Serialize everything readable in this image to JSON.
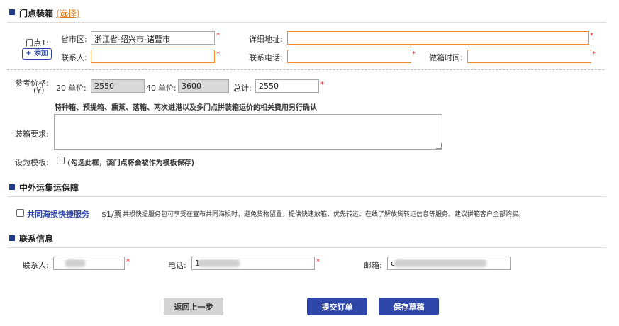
{
  "sections": {
    "door": {
      "title": "门点装箱",
      "select": "(选择)"
    },
    "guarantee": {
      "title": "中外运集运保障"
    },
    "contact": {
      "title": "联系信息"
    }
  },
  "door_point": {
    "label": "门点1:",
    "add_button": "+ 添加",
    "province_label": "省市区:",
    "province_value": "浙江省-绍兴市-诸暨市",
    "address_label": "详细地址:",
    "address_value": "",
    "contact_label": "联系人:",
    "contact_value": "",
    "phone_label": "联系电话:",
    "phone_value": "",
    "time_label": "做箱时间:",
    "time_value": ""
  },
  "price": {
    "label_line1": "参考价格:",
    "label_line2": "(¥)",
    "p20_label": "20'单价:",
    "p20_value": "2550",
    "p40_label": "40'单价:",
    "p40_value": "3600",
    "total_label": "总计:",
    "total_value": "2550",
    "note": "特种箱、预提箱、熏蒸、落箱、两次进港以及多门点拼装箱运价的相关费用另行确认"
  },
  "requirement": {
    "label": "装箱要求:",
    "value": ""
  },
  "template": {
    "label": "设为模板:",
    "hint": "(勾选此框，该门点将会被作为模板保存)",
    "checked": false
  },
  "service": {
    "name": "共同海损快捷服务",
    "price": "$1",
    "unit": "/票",
    "desc": "共损快提服务包可享受在宣布共同海损时，避免货物留置，提供快速放箱、优先转运、在线了解放货转运信息等服务。建议拼箱客户全部购买。",
    "checked": false
  },
  "contact": {
    "name_label": "联系人:",
    "name_value": "",
    "phone_label": "电话:",
    "phone_value": "1",
    "email_label": "邮箱:",
    "email_value": "c"
  },
  "buttons": {
    "back": "返回上一步",
    "submit": "提交订单",
    "draft": "保存草稿"
  },
  "colors": {
    "accent": "#f08a2c",
    "brand": "#2e46a8",
    "required": "#e02020"
  }
}
